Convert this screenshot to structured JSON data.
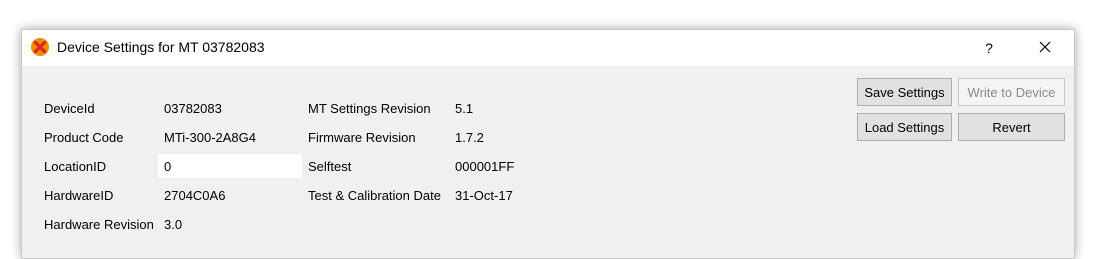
{
  "window": {
    "title": "Device Settings for MT 03782083",
    "help_glyph": "?",
    "close_glyph": "✕",
    "app_icon": "xsens-x-icon"
  },
  "fields": {
    "device_id": {
      "label": "DeviceId",
      "value": "03782083"
    },
    "product_code": {
      "label": "Product Code",
      "value": "MTi-300-2A8G4"
    },
    "location_id": {
      "label": "LocationID",
      "value": "0"
    },
    "hardware_id": {
      "label": "HardwareID",
      "value": "2704C0A6"
    },
    "hardware_revision": {
      "label": "Hardware Revision",
      "value": "3.0"
    },
    "mt_settings_revision": {
      "label": "MT Settings Revision",
      "value": "5.1"
    },
    "firmware_revision": {
      "label": "Firmware Revision",
      "value": "1.7.2"
    },
    "selftest": {
      "label": "Selftest",
      "value": "000001FF"
    },
    "test_calibration_date": {
      "label": "Test & Calibration Date",
      "value": "31-Oct-17"
    }
  },
  "buttons": {
    "save_settings": "Save Settings",
    "write_to_device": "Write to Device",
    "load_settings": "Load Settings",
    "revert": "Revert"
  },
  "colors": {
    "window_bg": "#f0f0f0",
    "titlebar_bg": "#ffffff",
    "icon_orange": "#f28c00",
    "icon_red": "#d8261c"
  }
}
